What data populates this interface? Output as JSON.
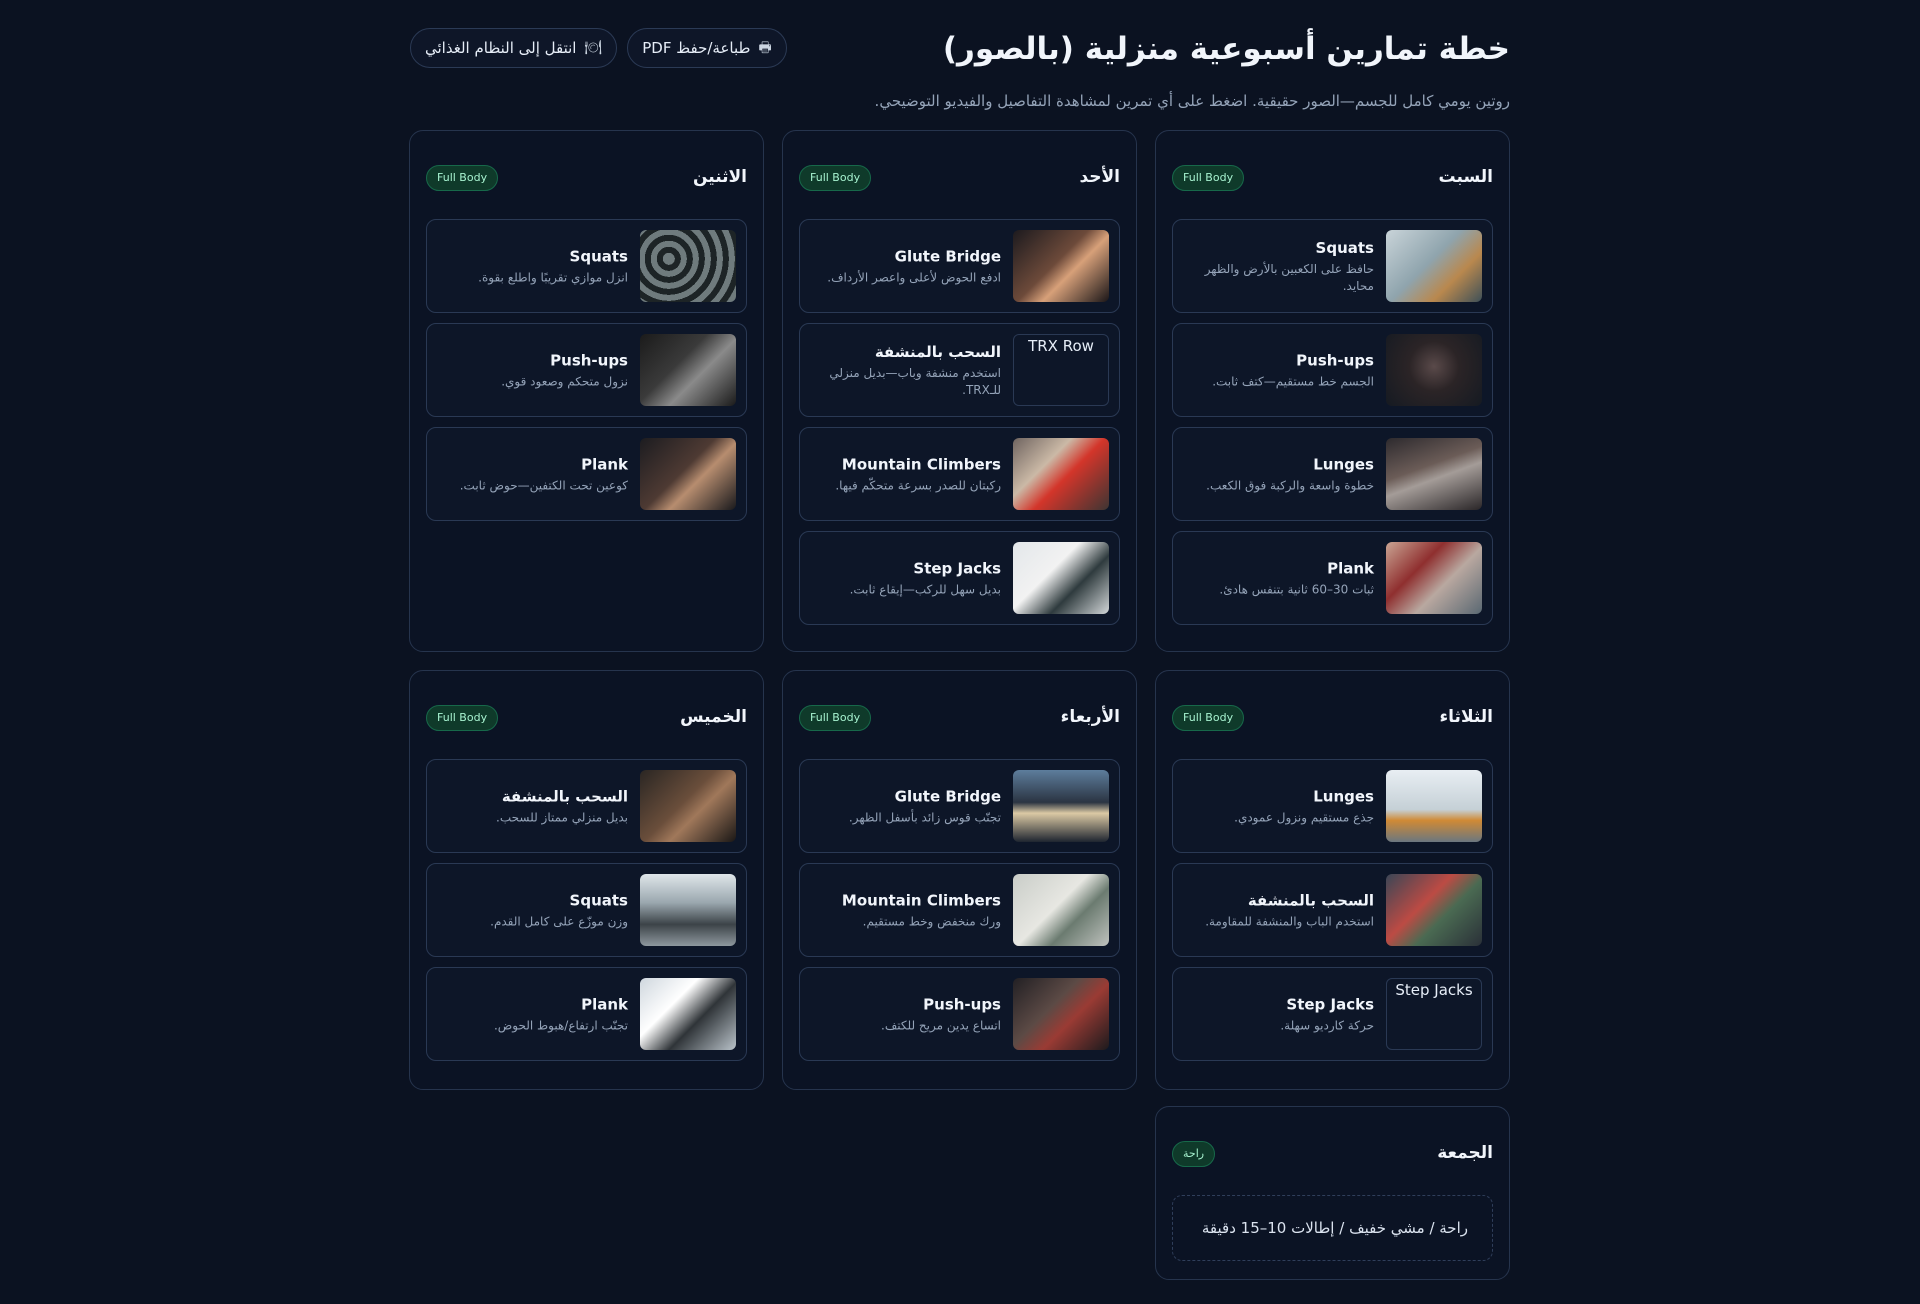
{
  "header": {
    "title": "خطة تمارين أسبوعية منزلية (بالصور)",
    "subtitle": "روتين يومي كامل للجسم—الصور حقيقية. اضغط على أي تمرين لمشاهدة التفاصيل والفيديو التوضيحي.",
    "nutrition_button": "انتقل إلى النظام الغذائي",
    "print_button": "طباعة/حفظ PDF",
    "nutrition_icon": "🍽",
    "print_icon": "🖶"
  },
  "colors": {
    "background": "#0b1221",
    "badge_bg": "#0f3a2a",
    "badge_text": "#a7f3d0"
  },
  "days": [
    {
      "name": "السبت",
      "badge": "Full Body",
      "exercises": [
        {
          "name": "Squats",
          "desc": "حافظ على الكعبين بالأرض والظهر محايد."
        },
        {
          "name": "Push-ups",
          "desc": "الجسم خط مستقيم—كتف ثابت."
        },
        {
          "name": "Lunges",
          "desc": "خطوة واسعة والركبة فوق الكعب."
        },
        {
          "name": "Plank",
          "desc": "ثبات 30–60 ثانية بتنفس هادئ."
        }
      ]
    },
    {
      "name": "الأحد",
      "badge": "Full Body",
      "exercises": [
        {
          "name": "Glute Bridge",
          "desc": "ادفع الحوض لأعلى واعصر الأرداف."
        },
        {
          "name": "السحب بالمنشفة",
          "desc": "استخدم منشفة وباب—بديل منزلي للـTRX.",
          "img_alt": "TRX Row"
        },
        {
          "name": "Mountain Climbers",
          "desc": "ركبتان للصدر بسرعة متحكّم فيها."
        },
        {
          "name": "Step Jacks",
          "desc": "بديل سهل للركب—إيقاع ثابت."
        }
      ]
    },
    {
      "name": "الاثنين",
      "badge": "Full Body",
      "exercises": [
        {
          "name": "Squats",
          "desc": "انزل موازي تقريبًا واطلع بقوة."
        },
        {
          "name": "Push-ups",
          "desc": "نزول متحكم وصعود قوي."
        },
        {
          "name": "Plank",
          "desc": "كوعين تحت الكتفين—حوض ثابت."
        }
      ]
    },
    {
      "name": "الثلاثاء",
      "badge": "Full Body",
      "exercises": [
        {
          "name": "Lunges",
          "desc": "جذع مستقيم ونزول عمودي."
        },
        {
          "name": "السحب بالمنشفة",
          "desc": "استخدم الباب والمنشفة للمقاومة."
        },
        {
          "name": "Step Jacks",
          "desc": "حركة كارديو سهلة.",
          "img_alt": "Step Jacks"
        }
      ]
    },
    {
      "name": "الأربعاء",
      "badge": "Full Body",
      "exercises": [
        {
          "name": "Glute Bridge",
          "desc": "تجنّب قوس زائد بأسفل الظهر."
        },
        {
          "name": "Mountain Climbers",
          "desc": "ورك منخفض وخط مستقيم."
        },
        {
          "name": "Push-ups",
          "desc": "اتساع يدين مريح للكتف."
        }
      ]
    },
    {
      "name": "الخميس",
      "badge": "Full Body",
      "exercises": [
        {
          "name": "السحب بالمنشفة",
          "desc": "بديل منزلي ممتاز للسحب."
        },
        {
          "name": "Squats",
          "desc": "وزن موزّع على كامل القدم."
        },
        {
          "name": "Plank",
          "desc": "تجنّب ارتفاع/هبوط الحوض."
        }
      ]
    },
    {
      "name": "الجمعة",
      "badge": "راحة",
      "rest_text": "راحة / مشي خفيف / إطالات 10–15 دقيقة"
    }
  ]
}
